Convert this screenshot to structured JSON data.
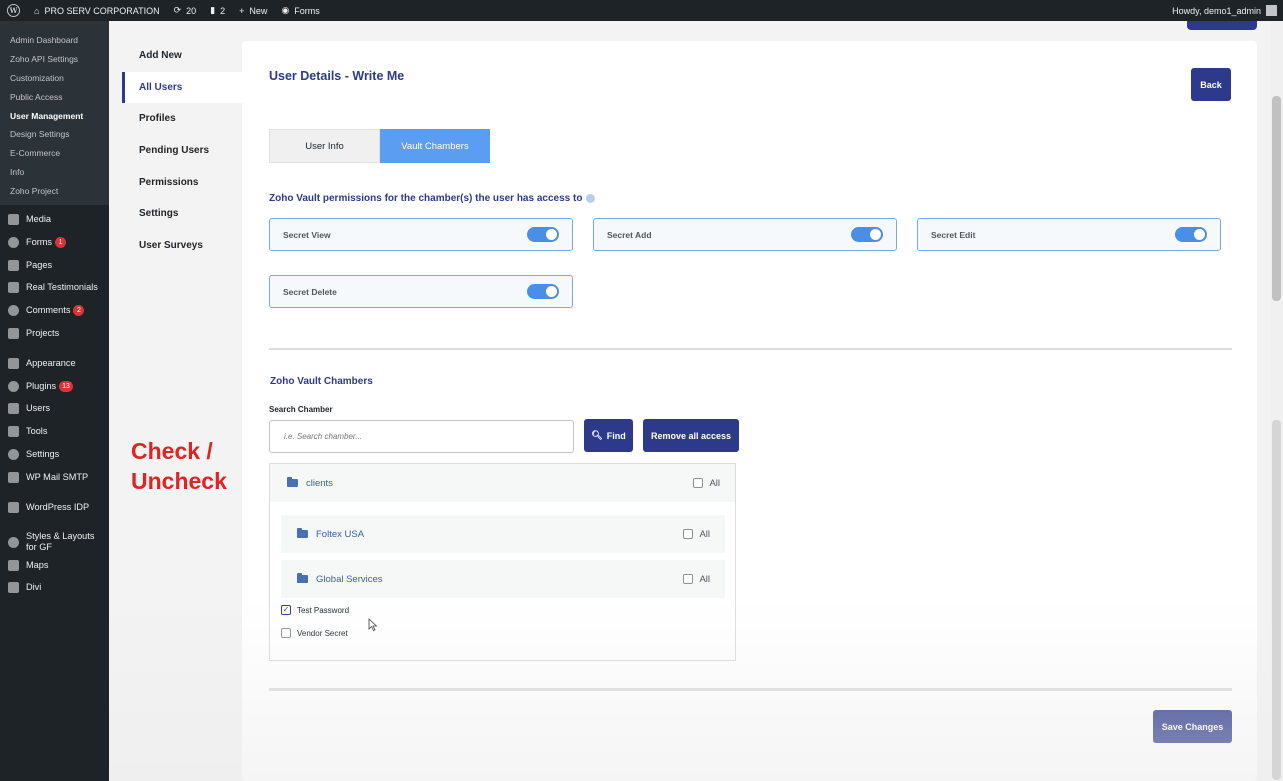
{
  "admin_bar": {
    "site_name": "PRO SERV CORPORATION",
    "updates_count": "20",
    "comments_count": "2",
    "new_label": "New",
    "forms_label": "Forms",
    "howdy": "Howdy, demo1_admin"
  },
  "sidebar": {
    "submenu": [
      {
        "label": "Admin Dashboard"
      },
      {
        "label": "Zoho API Settings"
      },
      {
        "label": "Customization"
      },
      {
        "label": "Public Access"
      },
      {
        "label": "User Management"
      },
      {
        "label": "Design Settings"
      },
      {
        "label": "E-Commerce"
      },
      {
        "label": "Info"
      },
      {
        "label": "Zoho Project"
      }
    ],
    "menu": [
      {
        "label": "Media",
        "icon": "media-icon"
      },
      {
        "label": "Forms",
        "icon": "forms-icon",
        "badge": "1"
      },
      {
        "label": "Pages",
        "icon": "pages-icon"
      },
      {
        "label": "Real Testimonials",
        "icon": "testimonials-icon"
      },
      {
        "label": "Comments",
        "icon": "comments-icon",
        "badge": "2"
      },
      {
        "label": "Projects",
        "icon": "pin-icon"
      },
      {
        "label": "Appearance",
        "icon": "brush-icon"
      },
      {
        "label": "Plugins",
        "icon": "plug-icon",
        "badge": "13"
      },
      {
        "label": "Users",
        "icon": "users-icon"
      },
      {
        "label": "Tools",
        "icon": "wrench-icon"
      },
      {
        "label": "Settings",
        "icon": "settings-icon"
      },
      {
        "label": "WP Mail SMTP",
        "icon": "mail-icon"
      },
      {
        "label": "WordPress IDP",
        "icon": "idp-icon"
      },
      {
        "label": "Styles & Layouts for GF",
        "icon": "gear-icon"
      },
      {
        "label": "Maps",
        "icon": "map-pin-icon"
      },
      {
        "label": "Divi",
        "icon": "divi-icon"
      }
    ]
  },
  "annotation": {
    "line1": "Check /",
    "line2": "Uncheck"
  },
  "subnav": [
    {
      "label": "Add New"
    },
    {
      "label": "All Users"
    },
    {
      "label": "Profiles"
    },
    {
      "label": "Pending Users"
    },
    {
      "label": "Permissions"
    },
    {
      "label": "Settings"
    },
    {
      "label": "User Surveys"
    }
  ],
  "main": {
    "title": "User Details - Write Me",
    "back_label": "Back",
    "tabs": [
      {
        "label": "User Info"
      },
      {
        "label": "Vault Chambers"
      }
    ],
    "permissions_heading": "Zoho Vault permissions for the chamber(s) the user has access to",
    "permissions": [
      {
        "label": "Secret View",
        "enabled": true
      },
      {
        "label": "Secret Add",
        "enabled": true
      },
      {
        "label": "Secret Edit",
        "enabled": true
      },
      {
        "label": "Secret Delete",
        "enabled": true
      }
    ],
    "chambers_heading": "Zoho Vault Chambers",
    "search_label": "Search Chamber",
    "search_placeholder": "i.e. Search chamber...",
    "find_label": "Find",
    "remove_label": "Remove all access",
    "tree": {
      "root": {
        "label": "clients",
        "all_label": "All"
      },
      "folders": [
        {
          "label": "Foltex USA",
          "all_label": "All"
        },
        {
          "label": "Global Services",
          "all_label": "All"
        }
      ],
      "secrets": [
        {
          "label": "Test Password",
          "checked": true
        },
        {
          "label": "Vendor Secret",
          "checked": false
        }
      ]
    },
    "save_label": "Save Changes"
  },
  "colors": {
    "brand_navy": "#2d3a8c",
    "active_tab": "#5b9df0",
    "annotation_red": "#e02424"
  }
}
